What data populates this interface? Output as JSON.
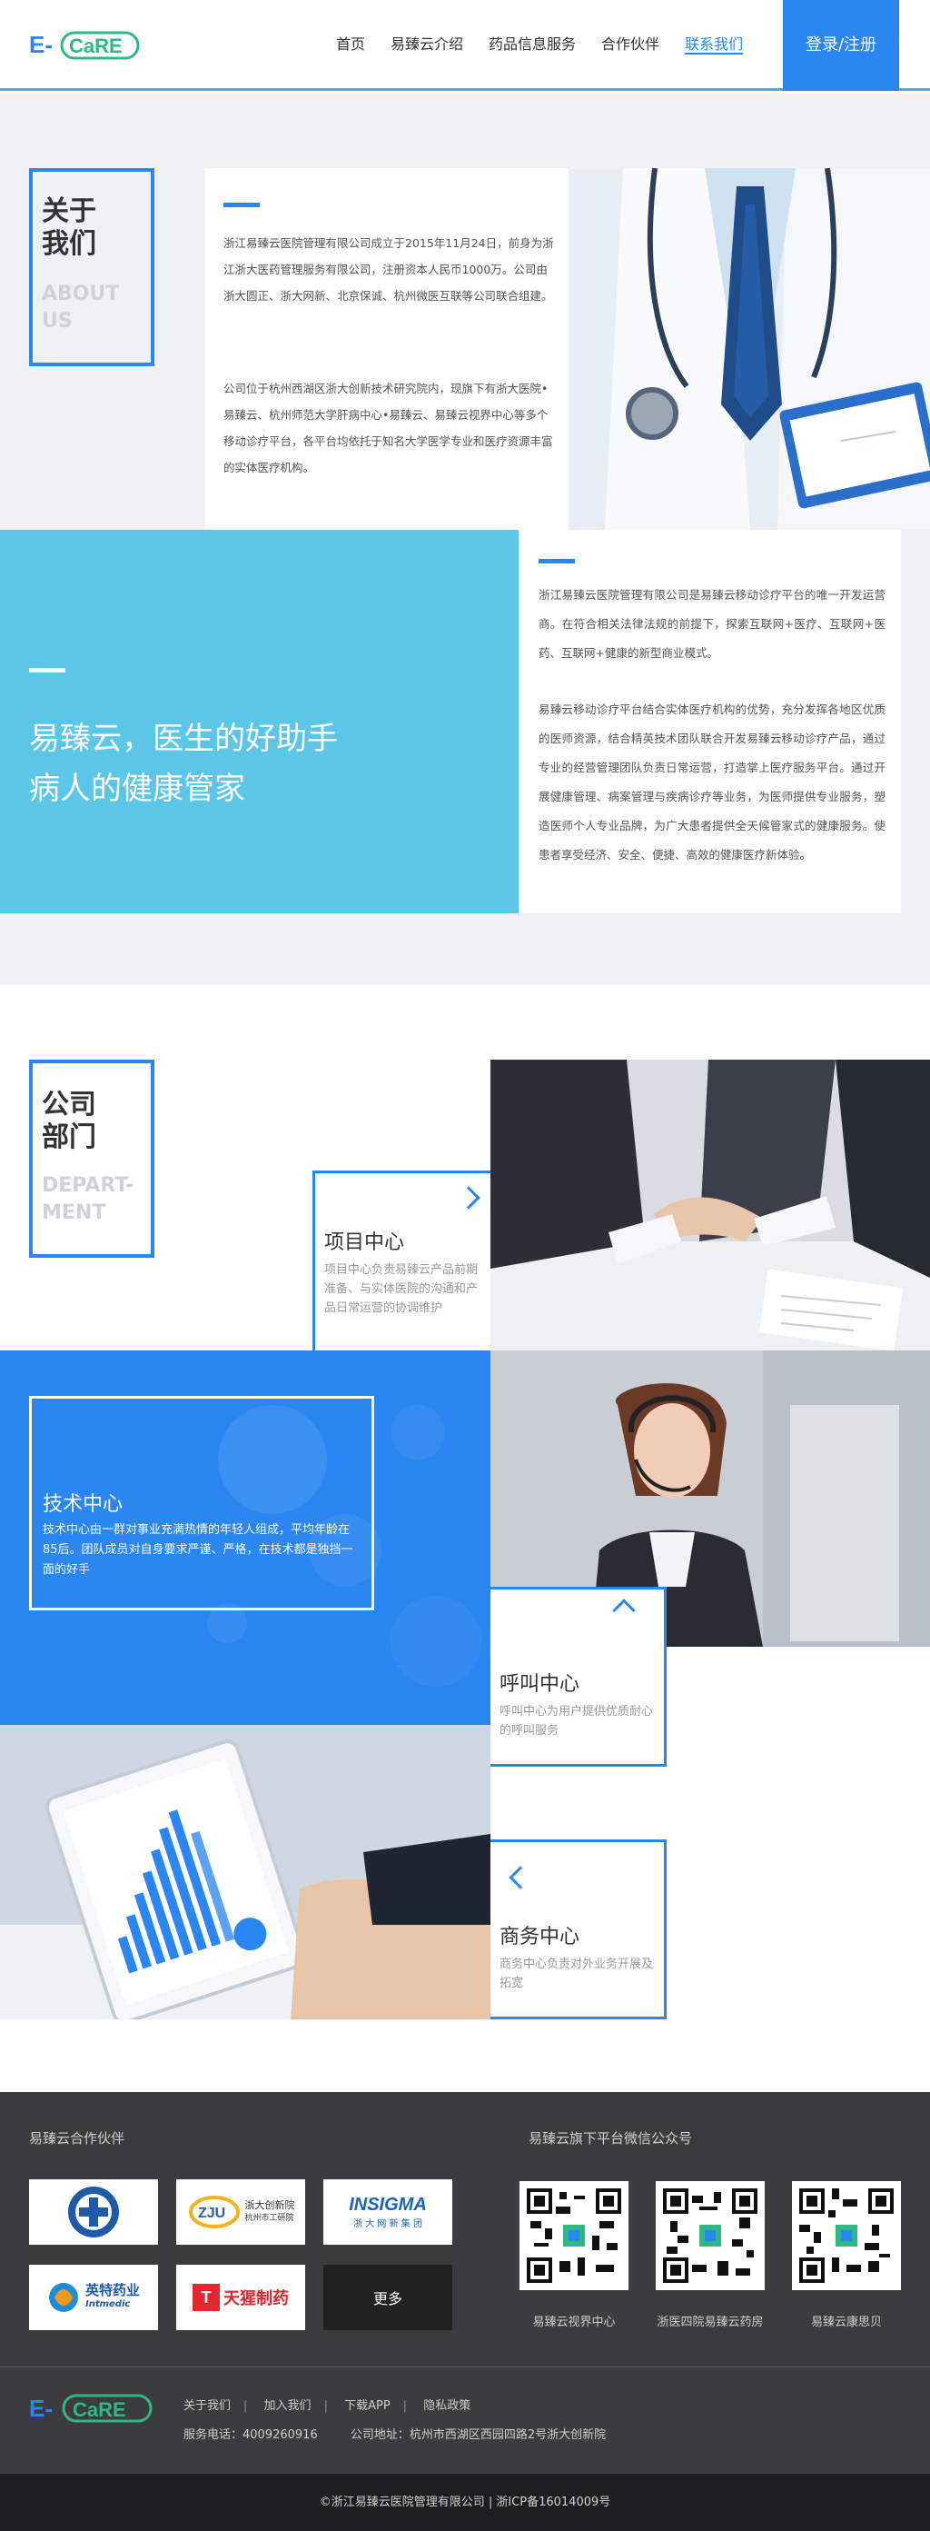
{
  "header": {
    "nav": [
      "首页",
      "易臻云介绍",
      "药品信息服务",
      "合作伙伴",
      "联系我们"
    ],
    "active_index": 4,
    "login": "登录/注册"
  },
  "about": {
    "title_cn_1": "关于",
    "title_cn_2": "我们",
    "title_en_1": "ABOUT",
    "title_en_2": "US",
    "para1": "浙江易臻云医院管理有限公司成立于2015年11月24日，前身为浙江浙大医药管理服务有限公司，注册资本人民币1000万。公司由浙大圆正、浙大网新、北京保诚、杭州微医互联等公司联合组建。",
    "para2": "公司位于杭州西湖区浙大创新技术研究院内，现旗下有浙大医院•易臻云、杭州师范大学肝病中心•易臻云、易臻云视界中心等多个移动诊疗平台，各平台均依托于知名大学医学专业和医疗资源丰富的实体医疗机构。"
  },
  "slogan": {
    "line1": "易臻云，医生的好助手",
    "line2": "病人的健康管家",
    "para1": "浙江易臻云医院管理有限公司是易臻云移动诊疗平台的唯一开发运营商。在符合相关法律法规的前提下，探索互联网+医疗、互联网+医药、互联网+健康的新型商业模式。",
    "para2": "易臻云移动诊疗平台结合实体医疗机构的优势，充分发挥各地区优质的医师资源，结合精英技术团队联合开发易臻云移动诊疗产品，通过专业的经营管理团队负责日常运营，打造掌上医疗服务平台。通过开展健康管理、病案管理与疾病诊疗等业务，为医师提供专业服务，塑造医师个人专业品牌，为广大患者提供全天候管家式的健康服务。使患者享受经济、安全、便捷、高效的健康医疗新体验。"
  },
  "department": {
    "title_cn_1": "公司",
    "title_cn_2": "部门",
    "title_en_1": "DEPART-",
    "title_en_2": "MENT",
    "project": {
      "name": "项目中心",
      "desc": "项目中心负责易臻云产品前期准备、与实体医院的沟通和产品日常运营的协调维护"
    },
    "tech": {
      "name": "技术中心",
      "desc": "技术中心由一群对事业充满热情的年轻人组成，平均年龄在85后。团队成员对自身要求严谨、严格，在技术都是独挡一面的好手"
    },
    "call": {
      "name": "呼叫中心",
      "desc": "呼叫中心为用户提供优质耐心的呼叫服务"
    },
    "business": {
      "name": "商务中心",
      "desc": "商务中心负责对外业务开展及拓宽"
    }
  },
  "footer": {
    "partners_title": "易臻云合作伙伴",
    "wechat_title": "易臻云旗下平台微信公众号",
    "partners": [
      "",
      "浙大创新院",
      "INSIGMA",
      "英特药业",
      "天猩制药"
    ],
    "partner_sub": [
      "",
      "杭州市工研院",
      "浙 大 网 新 集 团",
      "Intmedic",
      ""
    ],
    "more": "更多",
    "qr_labels": [
      "易臻云视界中心",
      "浙医四院易臻云药房",
      "易臻云康思贝"
    ],
    "links": [
      "关于我们",
      "加入我们",
      "下载APP",
      "隐私政策"
    ],
    "phone": "服务电话：4009260916",
    "address": "公司地址：杭州市西湖区西园四路2号浙大创新院",
    "copyright": "©浙江易臻云医院管理有限公司 | 浙ICP备16014009号"
  },
  "colors": {
    "primary": "#2a86f0",
    "cyan": "#5bc6e8",
    "footer": "#3c3c3e"
  }
}
